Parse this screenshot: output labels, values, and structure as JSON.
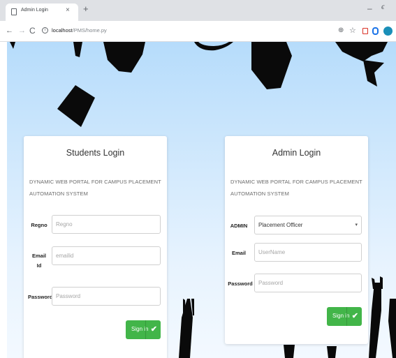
{
  "browser": {
    "tab_title": "Admin Login",
    "tab_close": "×",
    "new_tab": "+",
    "minimize": "–",
    "restore": "ϵ",
    "url_host": "localhost",
    "url_path": "/PMS/home.py"
  },
  "students_login": {
    "title": "Students Login",
    "subtitle": "DYNAMIC WEB PORTAL FOR CAMPUS PLACEMENT AUTOMATION SYSTEM",
    "regno_label": "Regno",
    "regno_placeholder": "Regno",
    "email_label": "Email Id",
    "email_placeholder": "emailid",
    "password_label": "Password",
    "password_placeholder": "Password",
    "signin_label": "Sign in"
  },
  "admin_login": {
    "title": "Admin Login",
    "subtitle": "DYNAMIC WEB PORTAL FOR CAMPUS PLACEMENT AUTOMATION SYSTEM",
    "role_label": "ADMIN",
    "role_selected": "Placement Officer",
    "email_label": "Email",
    "email_placeholder": "UserName",
    "password_label": "Password",
    "password_placeholder": "Password",
    "signin_label": "Sign in"
  },
  "icons": {
    "check": "✔",
    "back": "←",
    "forward": "→",
    "reload": "C",
    "zoom": "⊕",
    "star": "☆",
    "caret": "▾"
  },
  "colors": {
    "button_green": "#42b549",
    "background_top": "#b6dcfb",
    "silhouette": "#0a0a0a"
  }
}
